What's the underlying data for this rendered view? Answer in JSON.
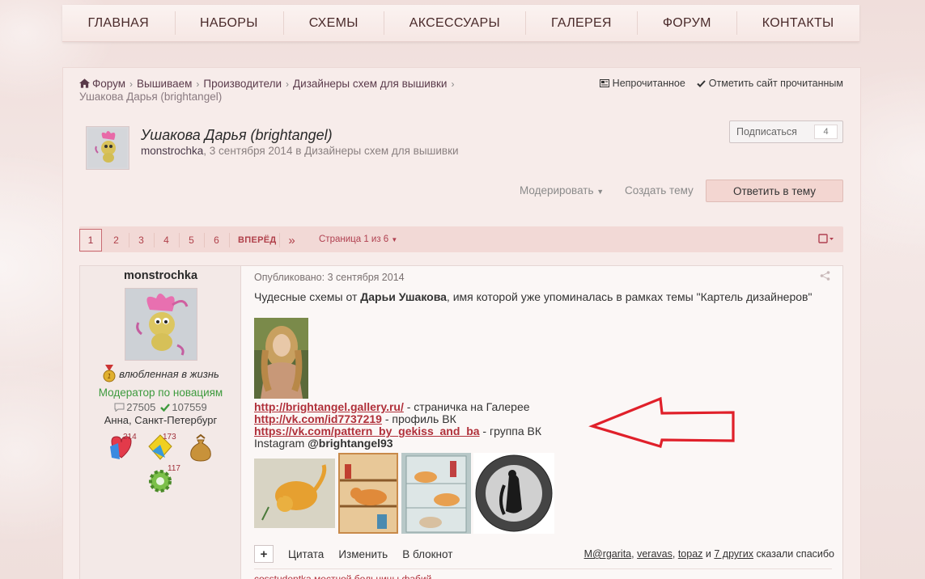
{
  "nav": {
    "items": [
      "ГЛАВНАЯ",
      "НАБОРЫ",
      "СХЕМЫ",
      "АКСЕССУАРЫ",
      "ГАЛЕРЕЯ",
      "ФОРУМ",
      "КОНТАКТЫ"
    ]
  },
  "breadcrumb": {
    "items": [
      "Форум",
      "Вышиваем",
      "Производители",
      "Дизайнеры схем для вышивки"
    ],
    "current": "Ушакова Дарья (brightangel)"
  },
  "top_actions": {
    "unread": "Непрочитанное",
    "mark_read": "Отметить сайт прочитанным"
  },
  "topic": {
    "title": "Ушакова Дарья (brightangel)",
    "author": "monstrochka",
    "meta_rest": ", 3 сентября 2014 в Дизайнеры схем для вышивки",
    "subscribe_label": "Подписаться",
    "subscribe_count": "4",
    "moderate": "Модерировать",
    "create_topic": "Создать тему",
    "reply": "Ответить в тему"
  },
  "pagination": {
    "pages": [
      "1",
      "2",
      "3",
      "4",
      "5",
      "6"
    ],
    "next": "ВПЕРЁД",
    "last": "»",
    "info": "Страница 1 из 6"
  },
  "post": {
    "author": "monstrochka",
    "rank": "влюбленная в жизнь",
    "role": "Модератор по новациям",
    "posts_count": "27505",
    "likes_count": "107559",
    "location": "Анна, Санкт-Петербург",
    "awards": [
      {
        "name": "heart-award",
        "count": "214"
      },
      {
        "name": "diamond-award",
        "count": "173"
      },
      {
        "name": "money-bag-award",
        "count": ""
      },
      {
        "name": "gear-award",
        "count": "117"
      }
    ],
    "date": "Опубликовано: 3 сентября 2014",
    "text_before": "Чудесные схемы от ",
    "text_bold": "Дарьи Ушакова",
    "text_after": ", имя которой уже упоминалась в рамках темы \"Картель дизайнеров\"",
    "links": [
      {
        "url": "http://brightangel.gallery.ru/",
        "desc": " - страничка на Галерее"
      },
      {
        "url": "http://vk.com/id7737219",
        "desc": " - профиль ВК"
      },
      {
        "url": "https://vk.com/pattern_by_gekiss_and_ba",
        "desc": " - группа ВК"
      }
    ],
    "instagram_label": "Instagram ",
    "instagram_handle": "@brightangel93",
    "footer": {
      "plus": "+",
      "quote": "Цитата",
      "edit": "Изменить",
      "notebook": "В блокнот"
    },
    "thanks": {
      "users": [
        "M@rgarita",
        "veravas",
        "topaz"
      ],
      "and": "и",
      "others": "7 других",
      "suffix": "сказали спасибо"
    },
    "next_text": "cosstudentka местной больницы фабий"
  },
  "colors": {
    "accent": "#b0303a",
    "green": "#3d9a3d",
    "arrow": "#e0202a"
  }
}
